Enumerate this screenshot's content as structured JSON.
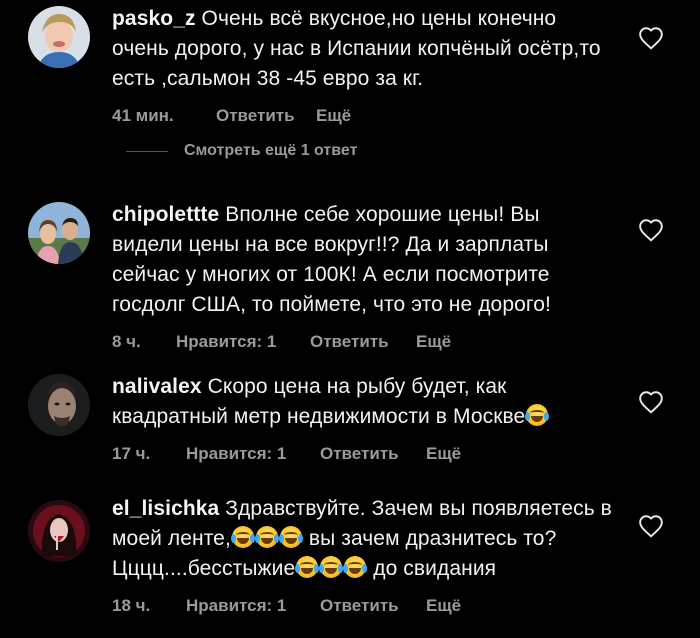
{
  "comments": [
    {
      "username": "pasko_z",
      "text": " Очень всё вкусное,но цены конечно очень дорого, у нас в Испании копчёный осётр,то есть ,сальмон 38 -45 евро за кг.",
      "time": "41 мин.",
      "likes": "",
      "reply": "Ответить",
      "more": "Ещё"
    },
    {
      "username": "chipolettte",
      "text": " Вполне себе хорошие цены! Вы видели цены на все вокруг!!? Да и зарплаты сейчас у многих от 100К! А если посмотрите госдолг США, то поймете, что это не дорого!",
      "time": "8 ч.",
      "likes": "Нравится: 1",
      "reply": "Ответить",
      "more": "Ещё"
    },
    {
      "username": "nalivalex",
      "text": " Скоро цена на рыбу будет, как квадратный метр недвижимости в Москве",
      "time": "17 ч.",
      "likes": "Нравится: 1",
      "reply": "Ответить",
      "more": "Ещё"
    },
    {
      "username": "el_lisichka",
      "text_a": " Здравствуйте. Зачем вы появляетесь в моей ленте,",
      "text_b": " вы зачем дразнитесь то? Цццц....бесстыжие",
      "text_c": " до свидания",
      "time": "18 ч.",
      "likes": "Нравится: 1",
      "reply": "Ответить",
      "more": "Ещё"
    }
  ],
  "view_more_replies": "Смотреть ещё 1 ответ",
  "icons": {
    "like": "heart-icon",
    "emoji": "face-with-tears-of-joy-emoji"
  },
  "colors": {
    "background": "#000000",
    "text": "#f2f2f2",
    "meta": "#9a9a9a"
  }
}
